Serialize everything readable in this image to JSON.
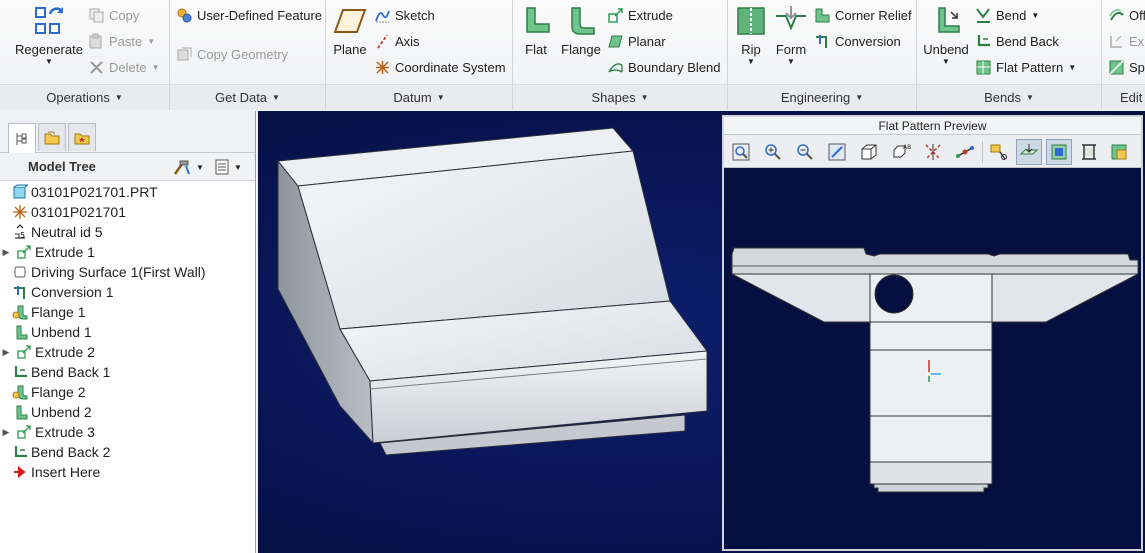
{
  "ribbon": {
    "operations": {
      "label": "Operations",
      "regenerate": "Regenerate",
      "copy": "Copy",
      "paste": "Paste",
      "delete": "Delete"
    },
    "get_data": {
      "label": "Get Data",
      "user_defined_feature": "User-Defined Feature",
      "copy_geometry": "Copy Geometry"
    },
    "datum": {
      "label": "Datum",
      "plane": "Plane",
      "sketch": "Sketch",
      "axis": "Axis",
      "coordinate_system": "Coordinate System"
    },
    "shapes": {
      "label": "Shapes",
      "flat": "Flat",
      "flange": "Flange",
      "extrude": "Extrude",
      "planar": "Planar",
      "boundary_blend": "Boundary Blend"
    },
    "engineering": {
      "label": "Engineering",
      "rip": "Rip",
      "form": "Form",
      "corner_relief": "Corner Relief",
      "conversion": "Conversion"
    },
    "bends": {
      "label": "Bends",
      "unbend": "Unbend",
      "bend": "Bend",
      "bend_back": "Bend Back",
      "flat_pattern": "Flat Pattern"
    },
    "editing": {
      "label": "Edit",
      "offset": "Off",
      "extend": "Ex",
      "split": "Sp"
    }
  },
  "model_tree": {
    "title": "Model Tree",
    "items": [
      {
        "label": "03101P021701.PRT",
        "icon": "part-icon",
        "expandable": false
      },
      {
        "label": "03101P021701",
        "icon": "csys-icon",
        "expandable": false
      },
      {
        "label": "Neutral id 5",
        "icon": "neutral-icon",
        "expandable": false
      },
      {
        "label": "Extrude 1",
        "icon": "extrude-icon",
        "expandable": true
      },
      {
        "label": "Driving Surface 1(First Wall)",
        "icon": "surface-icon",
        "expandable": false
      },
      {
        "label": "Conversion 1",
        "icon": "conversion-icon",
        "expandable": false
      },
      {
        "label": "Flange 1",
        "icon": "flange-icon",
        "expandable": false
      },
      {
        "label": "Unbend 1",
        "icon": "unbend-icon",
        "expandable": false
      },
      {
        "label": "Extrude 2",
        "icon": "extrude-icon",
        "expandable": true
      },
      {
        "label": "Bend Back 1",
        "icon": "bendback-icon",
        "expandable": false
      },
      {
        "label": "Flange 2",
        "icon": "flange-icon",
        "expandable": false
      },
      {
        "label": "Unbend 2",
        "icon": "unbend-icon",
        "expandable": false
      },
      {
        "label": "Extrude 3",
        "icon": "extrude-icon",
        "expandable": true
      },
      {
        "label": "Bend Back 2",
        "icon": "bendback-icon",
        "expandable": false
      },
      {
        "label": "Insert Here",
        "icon": "insert-arrow-icon",
        "expandable": false
      }
    ]
  },
  "preview": {
    "title": "Flat Pattern Preview"
  },
  "colors": {
    "viewport_bg": "#081452",
    "part_face": "#e6e9ee",
    "accent_green": "#2f9a52",
    "accent_blue": "#2d6bd0"
  }
}
